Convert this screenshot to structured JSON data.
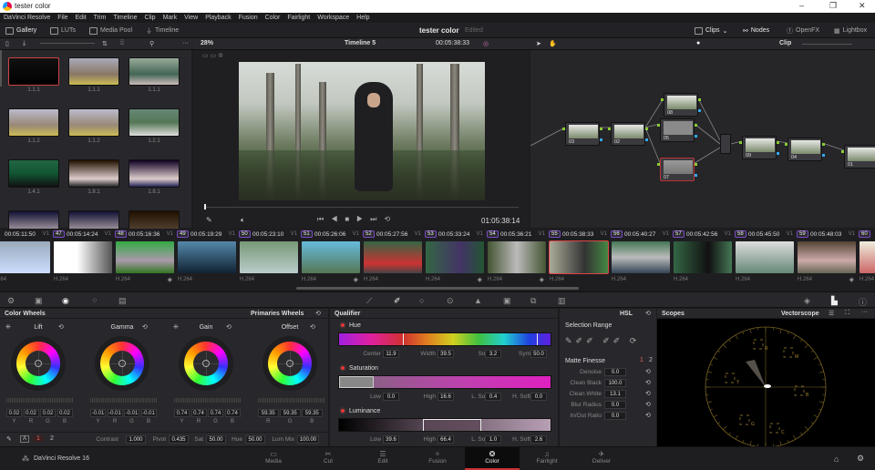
{
  "window": {
    "title": "tester color"
  },
  "menu": [
    "DaVinci Resolve",
    "File",
    "Edit",
    "Trim",
    "Timeline",
    "Clip",
    "Mark",
    "View",
    "Playback",
    "Fusion",
    "Color",
    "Fairlight",
    "Workspace",
    "Help"
  ],
  "toolbar": {
    "gallery": "Gallery",
    "luts": "LUTs",
    "media_pool": "Media Pool",
    "timeline": "Timeline",
    "project": "tester color",
    "status": "Edited",
    "clips": "Clips",
    "nodes": "Nodes",
    "openfx": "OpenFX",
    "lightbox": "Lightbox"
  },
  "viewer_bar": {
    "zoom": "28%",
    "timeline": "Timeline 5",
    "timecode": "00:05:38:33",
    "mode": "Clip"
  },
  "gallery": {
    "stills": [
      "1.1.1",
      "1.1.1",
      "1.1.1",
      "1.1.2",
      "1.1.2",
      "1.2.1",
      "1.4.1",
      "1.8.1",
      "1.8.1",
      "",
      "",
      ""
    ]
  },
  "viewer": {
    "timecode": "01:05:38:14",
    "progress": 0.0
  },
  "nodes": [
    {
      "label": "03"
    },
    {
      "label": "02"
    },
    {
      "label": "08"
    },
    {
      "label": "05"
    },
    {
      "label": "07"
    },
    {
      "label": "09"
    },
    {
      "label": "04"
    },
    {
      "label": "01"
    }
  ],
  "clips": [
    {
      "num": "",
      "tc": "00:05:11:50",
      "track": "V1",
      "codec": "H.264",
      "marker": false
    },
    {
      "num": "47",
      "tc": "00:05:14:24",
      "track": "V1",
      "codec": "H.264",
      "marker": false
    },
    {
      "num": "48",
      "tc": "00:05:16:36",
      "track": "V1",
      "codec": "H.264",
      "marker": true
    },
    {
      "num": "49",
      "tc": "00:05:19:29",
      "track": "V1",
      "codec": "H.264",
      "marker": false
    },
    {
      "num": "50",
      "tc": "00:05:23:10",
      "track": "V1",
      "codec": "H.264",
      "marker": false
    },
    {
      "num": "51",
      "tc": "00:05:26:06",
      "track": "V1",
      "codec": "H.264",
      "marker": true
    },
    {
      "num": "52",
      "tc": "00:05:27:56",
      "track": "V1",
      "codec": "H.264",
      "marker": false
    },
    {
      "num": "53",
      "tc": "00:05:33:24",
      "track": "V1",
      "codec": "H.264",
      "marker": true
    },
    {
      "num": "54",
      "tc": "00:05:36:21",
      "track": "V1",
      "codec": "H.264",
      "marker": true
    },
    {
      "num": "55",
      "tc": "00:05:38:33",
      "track": "V1",
      "codec": "H.264",
      "marker": false,
      "selected": true
    },
    {
      "num": "56",
      "tc": "00:05:40:27",
      "track": "V1",
      "codec": "H.264",
      "marker": false
    },
    {
      "num": "57",
      "tc": "00:05:42:56",
      "track": "V1",
      "codec": "H.264",
      "marker": false
    },
    {
      "num": "58",
      "tc": "00:05:45:50",
      "track": "V1",
      "codec": "H.264",
      "marker": false
    },
    {
      "num": "59",
      "tc": "00:05:48:03",
      "track": "V1",
      "codec": "H.264",
      "marker": true
    },
    {
      "num": "60",
      "tc": "",
      "track": "",
      "codec": "H.264",
      "marker": false
    }
  ],
  "color_wheels": {
    "title": "Color Wheels",
    "mode": "Primaries Wheels",
    "wheels": [
      {
        "name": "Lift",
        "values": [
          "0.02",
          "0.02",
          "0.02",
          "0.02"
        ],
        "channels": [
          "Y",
          "R",
          "G",
          "B"
        ]
      },
      {
        "name": "Gamma",
        "values": [
          "-0.01",
          "-0.01",
          "-0.01",
          "-0.01"
        ],
        "channels": [
          "Y",
          "R",
          "G",
          "B"
        ]
      },
      {
        "name": "Gain",
        "values": [
          "0.74",
          "0.74",
          "0.74",
          "0.74"
        ],
        "channels": [
          "Y",
          "R",
          "G",
          "B"
        ]
      },
      {
        "name": "Offset",
        "values": [
          "59.35",
          "59.35",
          "59.35"
        ],
        "channels": [
          "R",
          "G",
          "B"
        ]
      }
    ],
    "bottom": {
      "page1": "1",
      "page2": "2",
      "contrast_label": "Contrast",
      "contrast": "1.000",
      "pivot_label": "Pivot",
      "pivot": "0.435",
      "sat_label": "Sat",
      "sat": "50.00",
      "hue_label": "Hue",
      "hue": "50.00",
      "lummix_label": "Lum Mix",
      "lummix": "100.00"
    }
  },
  "qualifier": {
    "title": "Qualifier",
    "mode": "HSL",
    "hue": {
      "label": "Hue",
      "center_label": "Center",
      "center": "11.9",
      "width_label": "Width",
      "width": "39.5",
      "soft_label": "Soft",
      "soft": "3.2",
      "sym_label": "Sym",
      "sym": "50.0"
    },
    "saturation": {
      "label": "Saturation",
      "low_label": "Low",
      "low": "0.0",
      "high_label": "High",
      "high": "16.6",
      "lsoft_label": "L. Soft",
      "lsoft": "0.4",
      "hsoft_label": "H. Soft",
      "hsoft": "0.0"
    },
    "luminance": {
      "label": "Luminance",
      "low_label": "Low",
      "low": "39.6",
      "high_label": "High",
      "high": "66.4",
      "lsoft_label": "L. Soft",
      "lsoft": "1.0",
      "hsoft_label": "H. Soft",
      "hsoft": "2.6"
    }
  },
  "selection": {
    "title": "Selection Range",
    "matte_title": "Matte Finesse",
    "page1": "1",
    "page2": "2",
    "rows": [
      {
        "label": "Denoise",
        "value": "0.0"
      },
      {
        "label": "Clean Black",
        "value": "100.0"
      },
      {
        "label": "Clean White",
        "value": "13.1"
      },
      {
        "label": "Blur Radius",
        "value": "0.0"
      },
      {
        "label": "In/Out Ratio",
        "value": "0.0"
      }
    ]
  },
  "scopes": {
    "title": "Scopes",
    "type": "Vectorscope",
    "targets": [
      "R",
      "M",
      "B",
      "C",
      "G",
      "Y"
    ]
  },
  "pages": {
    "app": "DaVinci Resolve 16",
    "items": [
      "Media",
      "Cut",
      "Edit",
      "Fusion",
      "Color",
      "Fairlight",
      "Deliver"
    ],
    "active": "Color"
  }
}
